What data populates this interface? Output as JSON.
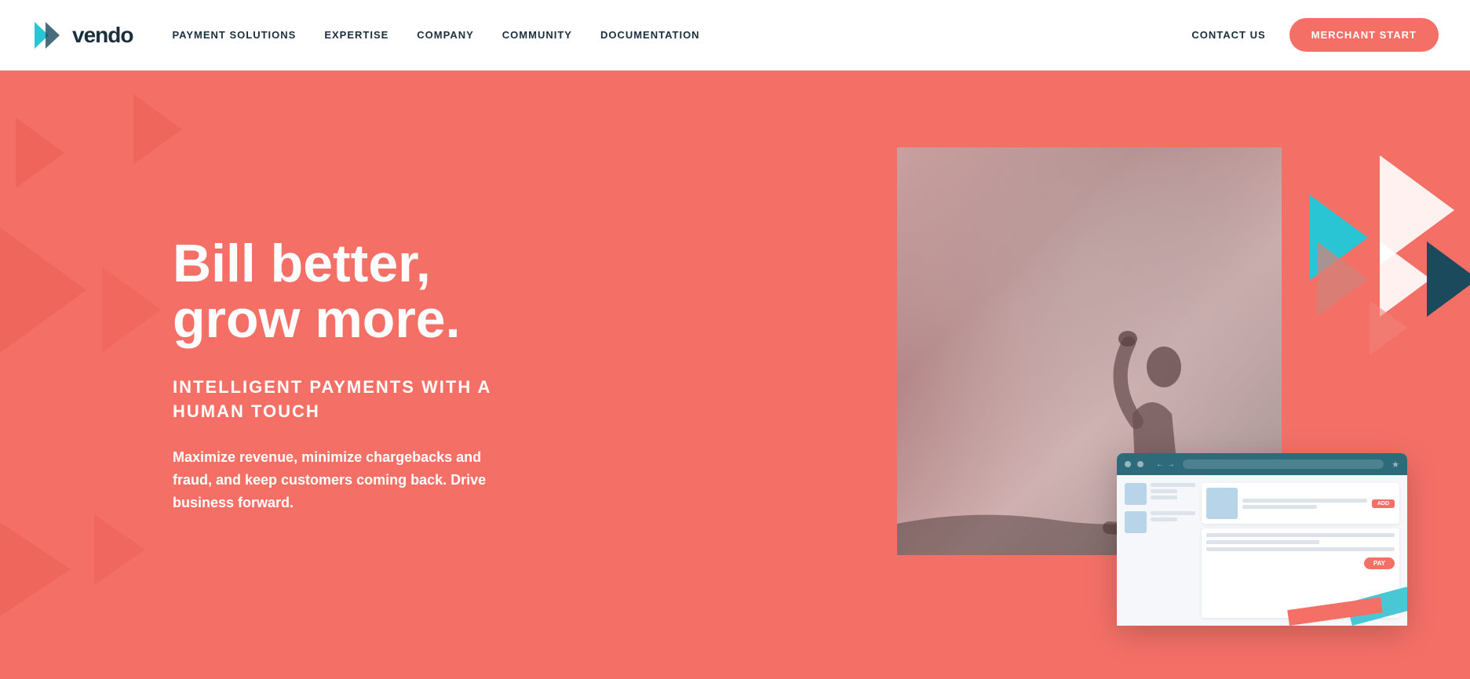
{
  "brand": {
    "name": "vendo",
    "logo_icon": "play-icon"
  },
  "navbar": {
    "links": [
      {
        "id": "payment-solutions",
        "label": "PAYMENT SOLUTIONS"
      },
      {
        "id": "expertise",
        "label": "EXPERTISE"
      },
      {
        "id": "company",
        "label": "COMPANY"
      },
      {
        "id": "community",
        "label": "COMMUNITY"
      },
      {
        "id": "documentation",
        "label": "DOCUMENTATION"
      }
    ],
    "contact_label": "CONTACT US",
    "merchant_btn_label": "MERCHANT START"
  },
  "hero": {
    "title_line1": "Bill better,",
    "title_line2": "grow more.",
    "subtitle": "INTELLIGENT PAYMENTS WITH A HUMAN TOUCH",
    "description": "Maximize revenue, minimize chargebacks and fraud, and keep customers coming back. Drive business forward.",
    "bg_color": "#f47067"
  },
  "mock_ui": {
    "add_label": "ADD",
    "pay_label": "PAY"
  },
  "colors": {
    "primary_red": "#f47067",
    "cyan": "#29c5d4",
    "dark_teal": "#1a4a5c",
    "white": "#ffffff",
    "nav_text": "#1a2e3b"
  }
}
